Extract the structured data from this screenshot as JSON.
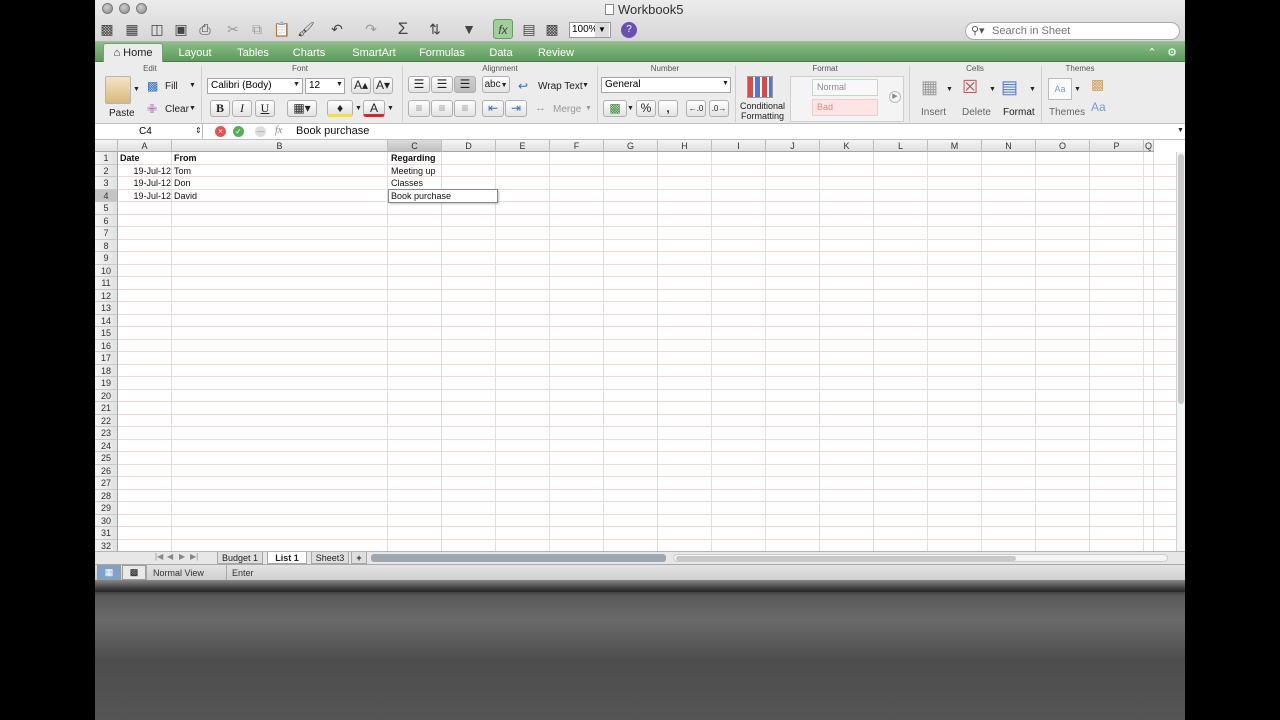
{
  "window": {
    "title": "Workbook5"
  },
  "toolbar": {
    "zoom": "100%",
    "search_placeholder": "Search in Sheet"
  },
  "tabs": [
    "Home",
    "Layout",
    "Tables",
    "Charts",
    "SmartArt",
    "Formulas",
    "Data",
    "Review"
  ],
  "ribbon": {
    "groups": {
      "edit": "Edit",
      "font": "Font",
      "alignment": "Alignment",
      "number": "Number",
      "format": "Format",
      "cells": "Cells",
      "themes": "Themes"
    },
    "paste": "Paste",
    "fill": "Fill",
    "clear": "Clear",
    "font_name": "Calibri (Body)",
    "font_size": "12",
    "bold": "B",
    "italic": "I",
    "underline": "U",
    "wrap_text": "Wrap Text",
    "merge": "Merge",
    "abc": "abc",
    "number_format": "General",
    "percent": "%",
    "comma": ",",
    "cond_format_1": "Conditional",
    "cond_format_2": "Formatting",
    "style_normal": "Normal",
    "style_bad": "Bad",
    "insert": "Insert",
    "delete": "Delete",
    "format": "Format",
    "themes": "Themes",
    "aa": "Aa"
  },
  "formula_bar": {
    "name_box": "C4",
    "fx": "fx",
    "content": "Book purchase"
  },
  "columns": [
    "A",
    "B",
    "C",
    "D",
    "E",
    "F",
    "G",
    "H",
    "I",
    "J",
    "K",
    "L",
    "M",
    "N",
    "O",
    "P",
    "Q"
  ],
  "cells": {
    "A1": "Date",
    "B1": "From",
    "C1": "Regarding",
    "A2": "19-Jul-12",
    "B2": "Tom",
    "C2": "Meeting up",
    "A3": "19-Jul-12",
    "B3": "Don",
    "C3": "Classes",
    "A4": "19-Jul-12",
    "B4": "David",
    "C4": "Book purchase"
  },
  "sheets": [
    "Budget 1",
    "List 1",
    "Sheet3"
  ],
  "active_sheet": "List 1",
  "add_sheet": "+",
  "status": {
    "view": "Normal View",
    "mode": "Enter"
  }
}
